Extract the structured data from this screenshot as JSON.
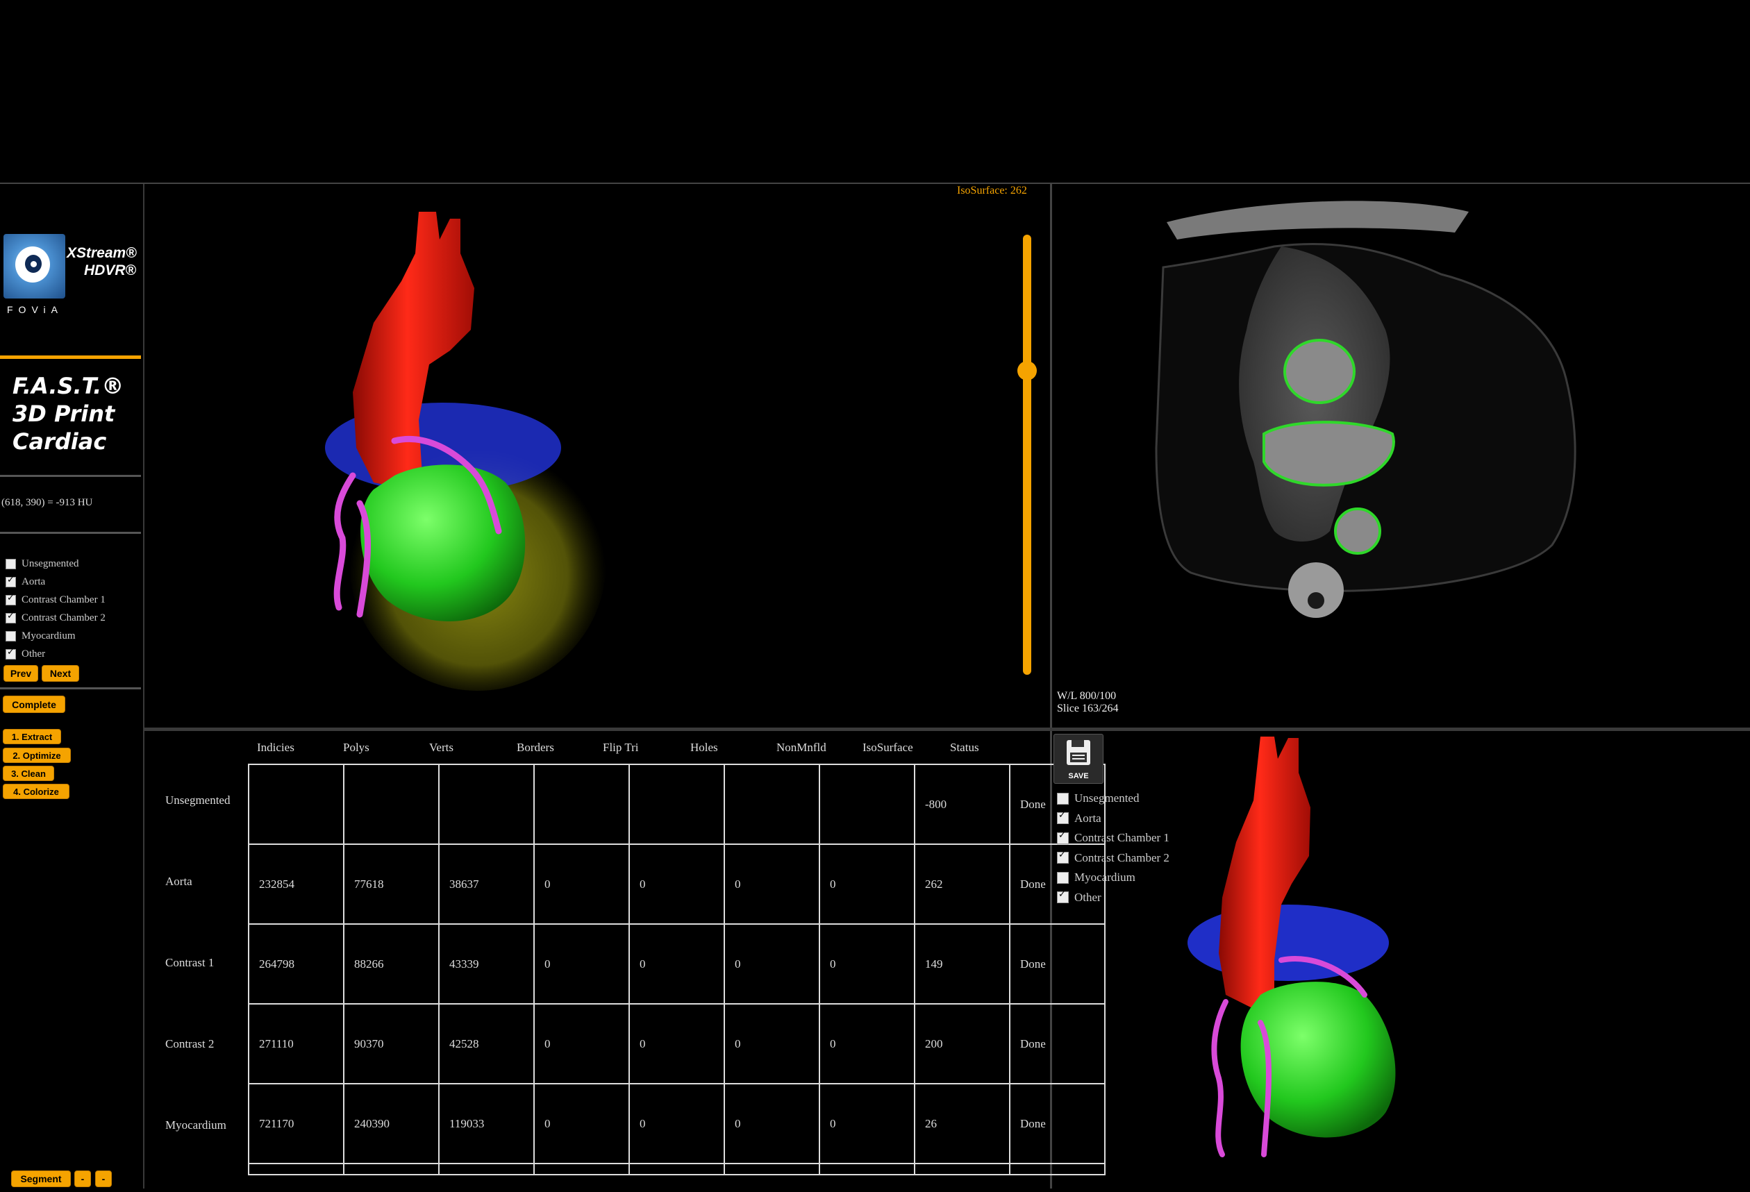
{
  "brand": {
    "line1": "XStream®",
    "line2": "HDVR®",
    "company": "FOViA"
  },
  "product": {
    "line1": "F.A.S.T.®",
    "line2": "3D Print",
    "line3": "Cardiac"
  },
  "hu_readout": "(618, 390) = -913 HU",
  "segments": [
    {
      "label": "Unsegmented",
      "checked": false
    },
    {
      "label": "Aorta",
      "checked": true
    },
    {
      "label": "Contrast Chamber 1",
      "checked": true
    },
    {
      "label": "Contrast Chamber 2",
      "checked": true
    },
    {
      "label": "Myocardium",
      "checked": false
    },
    {
      "label": "Other",
      "checked": true
    }
  ],
  "buttons": {
    "prev": "Prev",
    "next": "Next",
    "complete": "Complete",
    "extract": "1. Extract",
    "optimize": "2. Optimize",
    "clean": "3. Clean",
    "colorize": "4. Colorize",
    "segment": "Segment",
    "minus": "-",
    "minus2": "-"
  },
  "view3d": {
    "isosurface_label": "IsoSurface: 262",
    "slider_level": 0.3
  },
  "ct": {
    "wl": "W/L 800/100",
    "slice": "Slice 163/264"
  },
  "table": {
    "headers": [
      "Indicies",
      "Polys",
      "Verts",
      "Borders",
      "Flip Tri",
      "Holes",
      "NonMnfld",
      "IsoSurface",
      "Status"
    ],
    "rows": [
      {
        "label": "Unsegmented",
        "cells": [
          "",
          "",
          "",
          "",
          "",
          "",
          "",
          "-800",
          "Done"
        ]
      },
      {
        "label": "Aorta",
        "cells": [
          "232854",
          "77618",
          "38637",
          "0",
          "0",
          "0",
          "0",
          "262",
          "Done"
        ]
      },
      {
        "label": "Contrast 1",
        "cells": [
          "264798",
          "88266",
          "43339",
          "0",
          "0",
          "0",
          "0",
          "149",
          "Done"
        ]
      },
      {
        "label": "Contrast 2",
        "cells": [
          "271110",
          "90370",
          "42528",
          "0",
          "0",
          "0",
          "0",
          "200",
          "Done"
        ]
      },
      {
        "label": "Myocardium",
        "cells": [
          "721170",
          "240390",
          "119033",
          "0",
          "0",
          "0",
          "0",
          "26",
          "Done"
        ]
      }
    ]
  },
  "preview": {
    "save_label": "SAVE",
    "segments": [
      {
        "label": "Unsegmented",
        "checked": false
      },
      {
        "label": "Aorta",
        "checked": true
      },
      {
        "label": "Contrast Chamber 1",
        "checked": true
      },
      {
        "label": "Contrast Chamber 2",
        "checked": true
      },
      {
        "label": "Myocardium",
        "checked": false
      },
      {
        "label": "Other",
        "checked": true
      }
    ]
  },
  "colors": {
    "accent": "#f5a300",
    "aorta": "#e01a10",
    "chamber": "#2fd82a",
    "vessel": "#d94ad9",
    "contrast": "#2233dd",
    "myocardium": "#8a8a10"
  }
}
